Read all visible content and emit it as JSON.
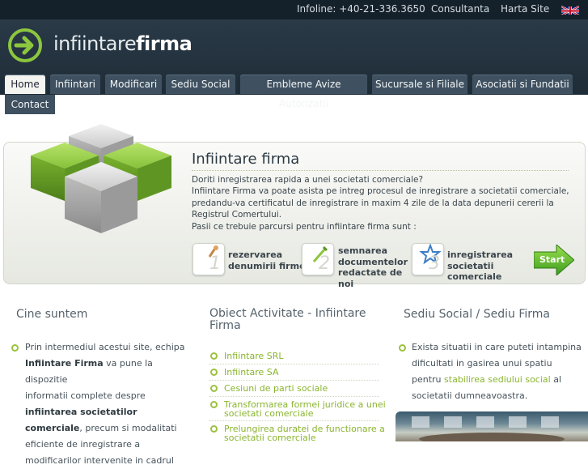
{
  "topbar": {
    "infoline": "Infoline: +40-21-336.3650",
    "consultanta": "Consultanta",
    "harta": "Harta Site"
  },
  "logo": {
    "light": "infiintare",
    "bold": "firma"
  },
  "nav": [
    "Home",
    "Infiintari",
    "Modificari",
    "Sediu Social",
    "Embleme Avize Autorizatii",
    "Sucursale si Filiale",
    "Asociatii si Fundatii",
    "Contact"
  ],
  "hero": {
    "title": "Infiintare firma",
    "lines": [
      "Doriti inregistrarea rapida a unei societati comerciale?",
      "Infiintare Firma va poate asista pe intreg procesul de inregistrare a societatii comerciale,",
      "predandu-va certificatul de inregistrare in maxim 4 zile de la data depunerii cererii la",
      "Registrul Comertului.",
      "Pasii ce trebuie parcursi pentru infiintare firma sunt :"
    ],
    "steps": [
      {
        "num": "1",
        "label": [
          "rezervarea",
          "denumirii firmei"
        ]
      },
      {
        "num": "2",
        "label": [
          "semnarea",
          "documentelor",
          "redactate de",
          "noi"
        ]
      },
      {
        "num": "3",
        "label": [
          "inregistrarea",
          "societatii",
          "comerciale"
        ]
      }
    ],
    "start": "Start"
  },
  "cine": {
    "title": "Cine suntem",
    "text": {
      "l1": "Prin intermediul acestui site, echipa",
      "b1": "Infiintare Firma",
      "l2": " va pune la dispozitie",
      "l3": "informatii complete despre",
      "b2a": "infiintarea societatilor",
      "b2b": "comerciale",
      "l4": ", precum si modalitati",
      "l5": "eficiente de inregistrare a",
      "l6": "modificarilor intervenite in cadrul"
    }
  },
  "obiect": {
    "title": [
      "Obiect Activitate - Infiintare",
      "Firma"
    ],
    "links": [
      [
        "Infiintare SRL"
      ],
      [
        "Infiintare SA"
      ],
      [
        "Cesiuni de parti sociale"
      ],
      [
        "Transformarea formei juridice a unei",
        "societati comerciale"
      ],
      [
        "Prelungirea duratei de functionare a",
        "societatii comerciale"
      ]
    ]
  },
  "sediu": {
    "title": "Sediu Social / Sediu Firma",
    "l1": "Exista situatii in care puteti intampina",
    "l2": "dificultati in gasirea unui spatiu",
    "l3a": "pentru ",
    "link": "stabilirea sediului social",
    "l3b": " al",
    "l4": "societatii dumneavoastra."
  },
  "colors": {
    "accent": "#8ab52e",
    "nav": "#3f5160",
    "header": "#1e2c37"
  }
}
